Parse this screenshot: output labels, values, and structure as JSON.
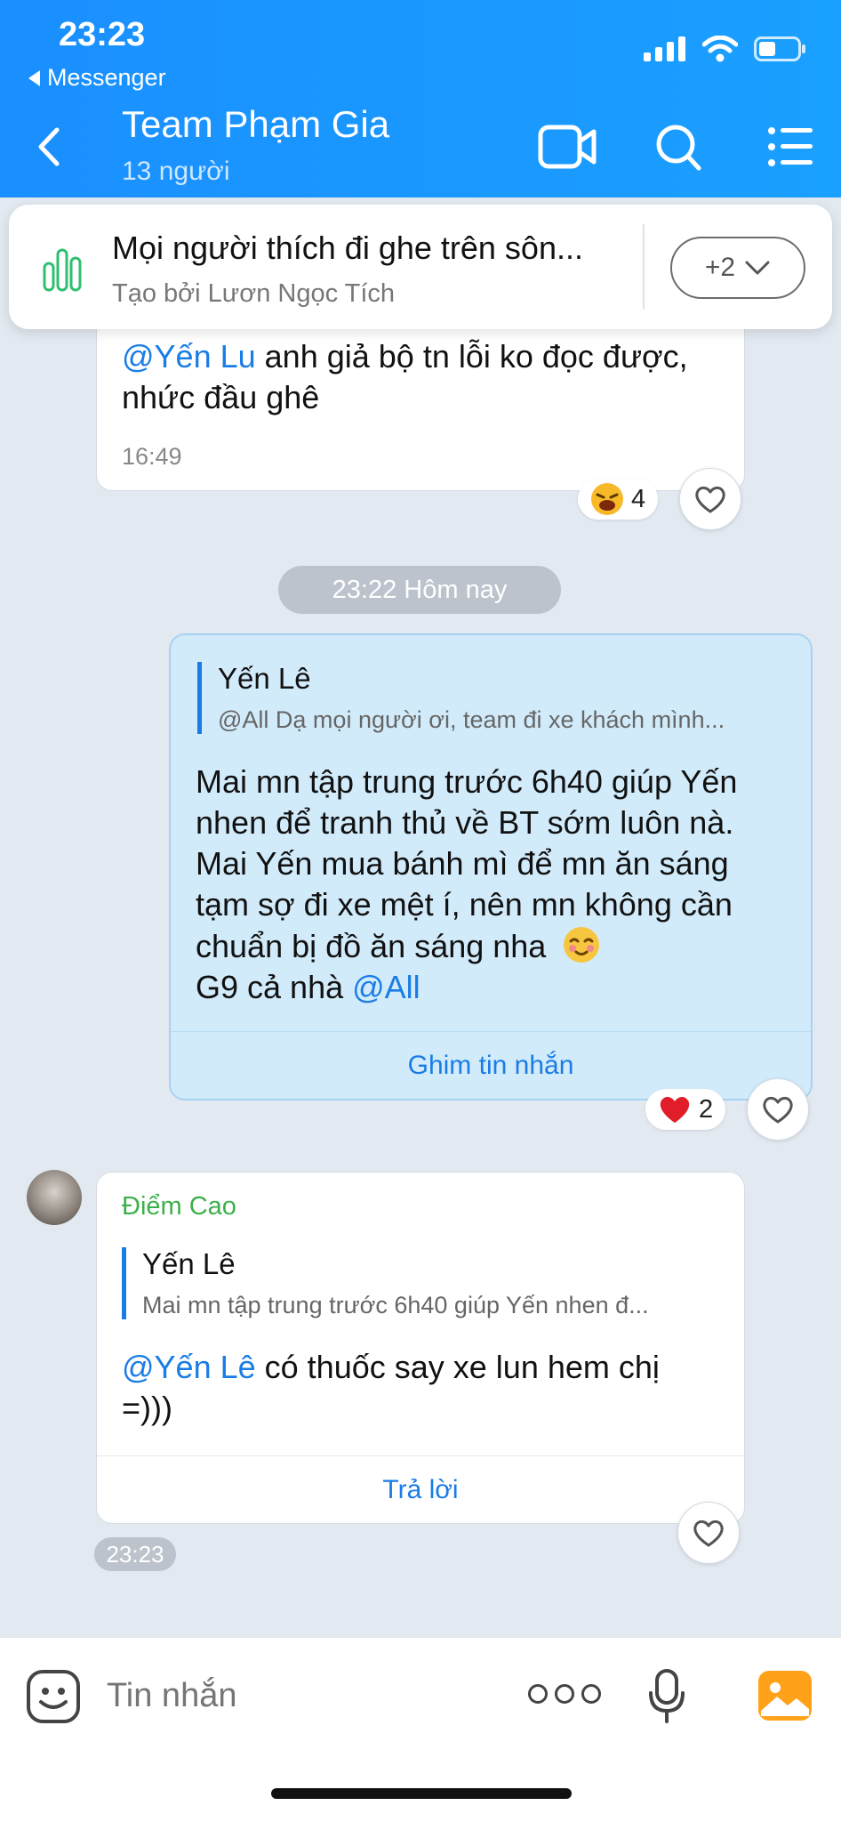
{
  "status_bar": {
    "time": "23:23",
    "back_app": "Messenger"
  },
  "header": {
    "title": "Team Phạm Gia",
    "subtitle": "13 người"
  },
  "pinned": {
    "title": "Mọi người thích đi ghe trên sôn...",
    "subtitle": "Tạo bởi Lươn Ngọc Tích",
    "more_label": "+2"
  },
  "messages": [
    {
      "mention": "@Yến Lu",
      "text_line1": " anh giả bộ tn lỗi ko đọc được,",
      "text_line2": "nhức đầu ghê",
      "time": "16:49",
      "reaction_count": "4"
    },
    {
      "quote_name": "Yến Lê",
      "quote_text": "@All  Dạ mọi người ơi, team đi xe khách mình...",
      "lines": [
        "Mai mn tập trung trước 6h40 giúp Yến",
        "nhen để tranh thủ về BT sớm luôn nà.",
        "Mai Yến mua bánh mì để mn ăn sáng",
        "tạm sợ đi xe mệt í, nên mn không cần",
        "chuẩn bị đồ ăn sáng nha"
      ],
      "last_line": "G9 cả nhà ",
      "mention": "@All",
      "action": "Ghim tin nhắn",
      "reaction_count": "2"
    },
    {
      "sender": "Điểm Cao",
      "quote_name": "Yến Lê",
      "quote_text": "Mai mn tập trung trước 6h40 giúp Yến nhen đ...",
      "mention": "@Yến Lê",
      "text_line1": " có thuốc say xe lun hem chị",
      "text_line2": "=)))",
      "action": "Trả lời",
      "time": "23:23"
    }
  ],
  "date_divider": "23:22 Hôm nay",
  "input": {
    "placeholder": "Tin nhắn"
  },
  "colors": {
    "header": "#1a8fff",
    "mention": "#1a7de6",
    "sender": "#3cb04a",
    "own_bubble": "#d2ebfa"
  }
}
